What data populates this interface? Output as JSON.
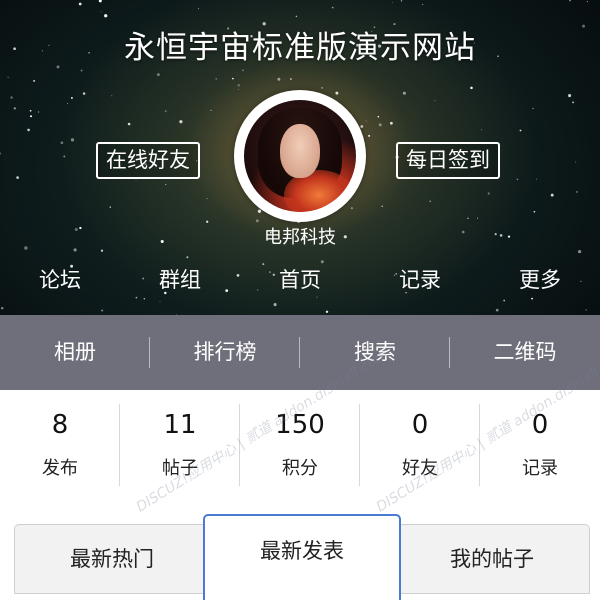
{
  "header": {
    "title": "永恒宇宙标准版演示网站"
  },
  "profile": {
    "online_friends_label": "在线好友",
    "checkin_label": "每日签到",
    "username": "电邦科技"
  },
  "nav": {
    "items": [
      {
        "label": "论坛"
      },
      {
        "label": "群组"
      },
      {
        "label": "首页"
      },
      {
        "label": "记录"
      },
      {
        "label": "更多"
      }
    ]
  },
  "subnav": {
    "items": [
      {
        "label": "相册"
      },
      {
        "label": "排行榜"
      },
      {
        "label": "搜索"
      },
      {
        "label": "二维码"
      }
    ]
  },
  "stats": [
    {
      "value": "8",
      "label": "发布"
    },
    {
      "value": "11",
      "label": "帖子"
    },
    {
      "value": "150",
      "label": "积分"
    },
    {
      "value": "0",
      "label": "好友"
    },
    {
      "value": "0",
      "label": "记录"
    }
  ],
  "watermark": {
    "text": "DISCUZ!应用中心 | 贰道 addon.dismall.com"
  },
  "tabs": [
    {
      "label": "最新热门"
    },
    {
      "label": "最新发表"
    },
    {
      "label": "我的帖子"
    }
  ],
  "colors": {
    "subnav_bg": "#6f6f7b",
    "active_tab_border": "#4a7bd1"
  }
}
